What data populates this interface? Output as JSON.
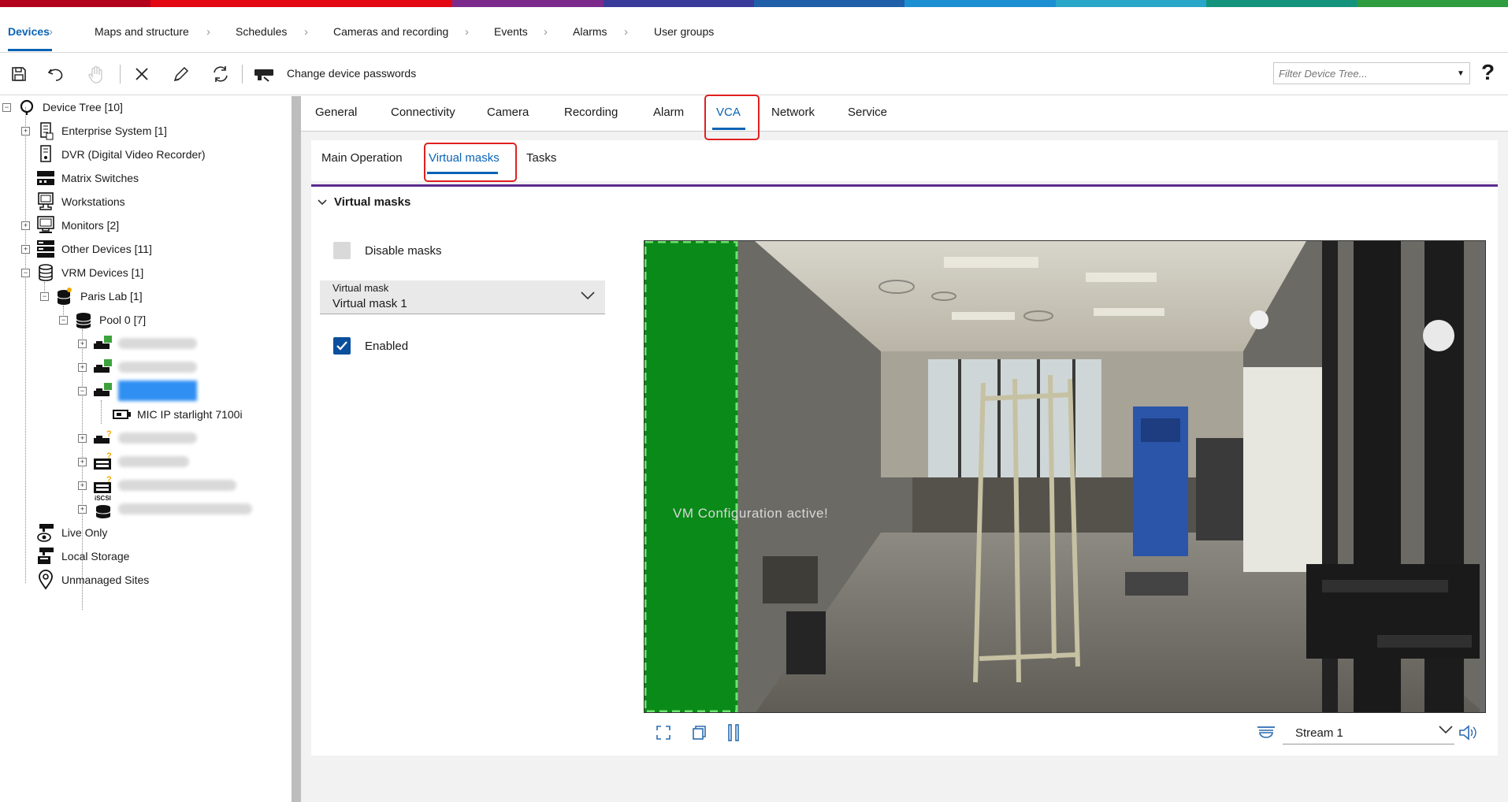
{
  "brand_colors": [
    "#b3001b",
    "#e30613",
    "#e30613",
    "#7b2a8c",
    "#3a3a9a",
    "#1f5fa8",
    "#1b8fd1",
    "#2aa6c9",
    "#14947d",
    "#2e9c3f"
  ],
  "nav": {
    "items": [
      {
        "label": "Devices",
        "active": true
      },
      {
        "label": "Maps and structure"
      },
      {
        "label": "Schedules"
      },
      {
        "label": "Cameras and recording"
      },
      {
        "label": "Events"
      },
      {
        "label": "Alarms"
      },
      {
        "label": "User groups"
      }
    ],
    "separator": "›"
  },
  "toolbar": {
    "change_passwords_label": "Change device passwords",
    "filter_placeholder": "Filter Device Tree...",
    "help_label": "?"
  },
  "tree": {
    "root": "Device Tree [10]",
    "enterprise": "Enterprise System [1]",
    "dvr": "DVR (Digital Video Recorder)",
    "matrix": "Matrix Switches",
    "workstations": "Workstations",
    "monitors": "Monitors [2]",
    "other": "Other Devices [11]",
    "vrm": "VRM Devices [1]",
    "paris": "Paris Lab [1]",
    "pool": "Pool 0 [7]",
    "camera": "MIC IP starlight 7100i",
    "iscsi_badge": "iSCSI",
    "live_only": "Live Only",
    "local_storage": "Local Storage",
    "unmanaged": "Unmanaged Sites"
  },
  "tabs": {
    "general": "General",
    "connectivity": "Connectivity",
    "camera": "Camera",
    "recording": "Recording",
    "alarm": "Alarm",
    "vca": "VCA",
    "network": "Network",
    "service": "Service"
  },
  "subtabs": {
    "main": "Main Operation",
    "virtual": "Virtual masks",
    "tasks": "Tasks"
  },
  "section": {
    "title": "Virtual masks",
    "disable_masks": "Disable masks",
    "disable_checked": false,
    "virtual_mask_label": "Virtual mask",
    "virtual_mask_value": "Virtual mask 1",
    "enabled_label": "Enabled",
    "enabled_checked": true
  },
  "video": {
    "overlay_text": "VM Configuration active!",
    "stream_value": "Stream 1",
    "mask_color": "#0a8a18"
  }
}
